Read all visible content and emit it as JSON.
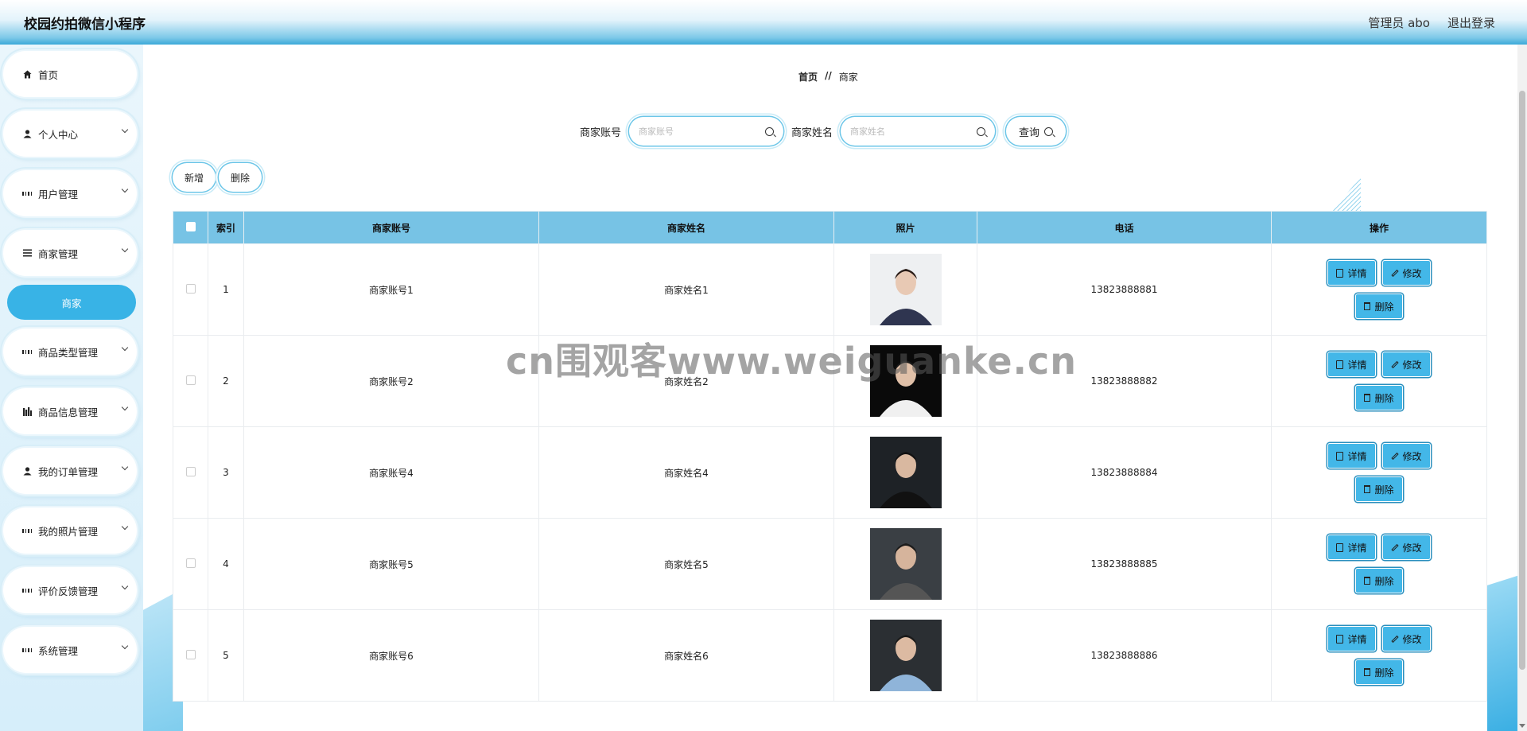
{
  "header": {
    "title": "校园约拍微信小程序",
    "admin_label": "管理员 abo",
    "logout_label": "退出登录"
  },
  "sidebar": {
    "items": [
      {
        "label": "首页",
        "icon": "home-icon"
      },
      {
        "label": "个人中心",
        "icon": "user-icon"
      },
      {
        "label": "用户管理",
        "icon": "grid-icon"
      },
      {
        "label": "商家管理",
        "icon": "list-icon"
      },
      {
        "label": "商家",
        "icon": ""
      },
      {
        "label": "商品类型管理",
        "icon": "grid-icon"
      },
      {
        "label": "商品信息管理",
        "icon": "chart-icon"
      },
      {
        "label": "我的订单管理",
        "icon": "user-icon"
      },
      {
        "label": "我的照片管理",
        "icon": "grid-icon"
      },
      {
        "label": "评价反馈管理",
        "icon": "grid-icon"
      },
      {
        "label": "系统管理",
        "icon": "grid-icon"
      }
    ]
  },
  "breadcrumb": {
    "home": "首页",
    "sep": "//",
    "current": "商家"
  },
  "search": {
    "account_label": "商家账号",
    "account_placeholder": "商家账号",
    "name_label": "商家姓名",
    "name_placeholder": "商家姓名",
    "query_label": "查询"
  },
  "actions": {
    "add_label": "新增",
    "delete_label": "删除"
  },
  "table": {
    "columns": [
      "索引",
      "商家账号",
      "商家姓名",
      "照片",
      "电话",
      "操作"
    ],
    "rows": [
      {
        "index": "1",
        "account": "商家账号1",
        "name": "商家姓名1",
        "phone": "13823888881"
      },
      {
        "index": "2",
        "account": "商家账号2",
        "name": "商家姓名2",
        "phone": "13823888882"
      },
      {
        "index": "3",
        "account": "商家账号4",
        "name": "商家姓名4",
        "phone": "13823888884"
      },
      {
        "index": "4",
        "account": "商家账号5",
        "name": "商家姓名5",
        "phone": "13823888885"
      },
      {
        "index": "5",
        "account": "商家账号6",
        "name": "商家姓名6",
        "phone": "13823888886"
      }
    ],
    "op_detail": "详情",
    "op_edit": "修改",
    "op_delete": "删除"
  },
  "watermark": "cn围观客www.weiguanke.cn",
  "colors": {
    "accent": "#38b3e6",
    "table_header": "#77c3e5",
    "button": "#43b7e8"
  }
}
